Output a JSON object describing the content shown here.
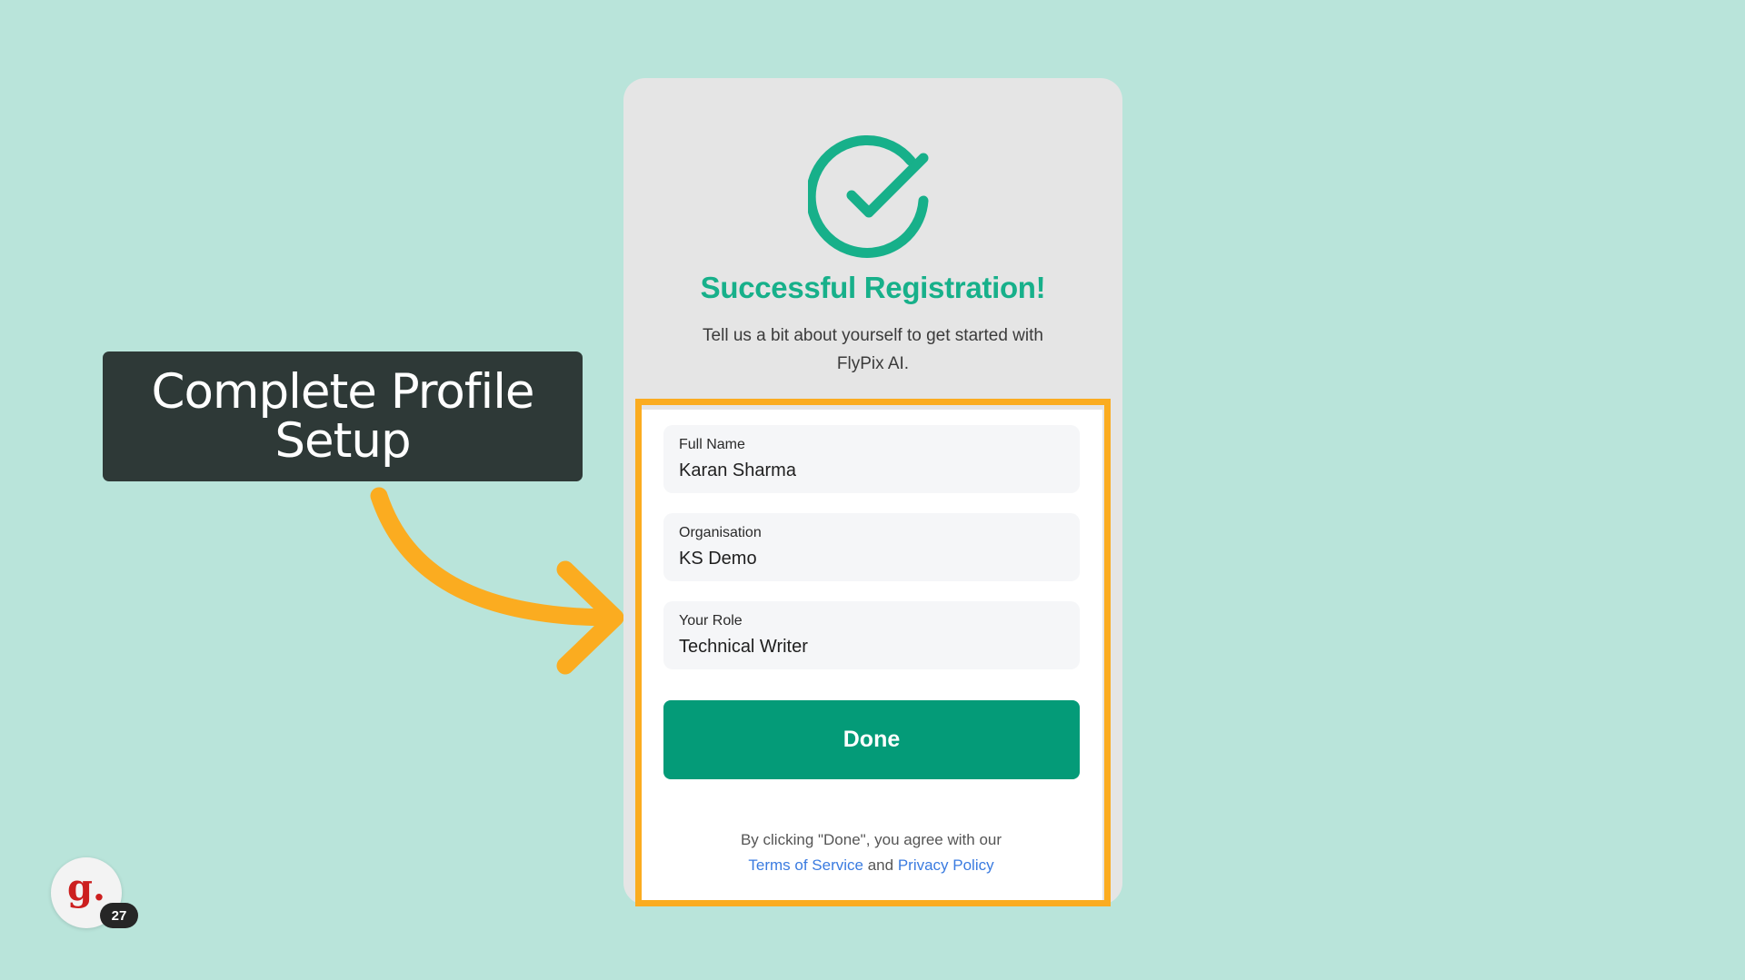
{
  "callout": {
    "line1": "Complete Profile",
    "line2": "Setup"
  },
  "card": {
    "icon": "check-circle-icon",
    "title": "Successful Registration!",
    "subtitle": "Tell us a bit about yourself to get started with FlyPix AI.",
    "fields": [
      {
        "label": "Full Name",
        "value": "Karan Sharma"
      },
      {
        "label": "Organisation",
        "value": "KS Demo"
      },
      {
        "label": "Your Role",
        "value": "Technical Writer"
      }
    ],
    "done_label": "Done",
    "terms": {
      "prefix": "By clicking \"Done\", you agree with our",
      "tos_link": "Terms of Service",
      "and": "and",
      "privacy_link": "Privacy Policy"
    }
  },
  "avatar": {
    "letter": "g.",
    "badge": "27"
  },
  "colors": {
    "background": "#b9e4da",
    "accent_green": "#17b08a",
    "button_green": "#049b78",
    "highlight_orange": "#fbac20",
    "callout_bg": "#2e3937",
    "link_blue": "#3a7be0"
  }
}
